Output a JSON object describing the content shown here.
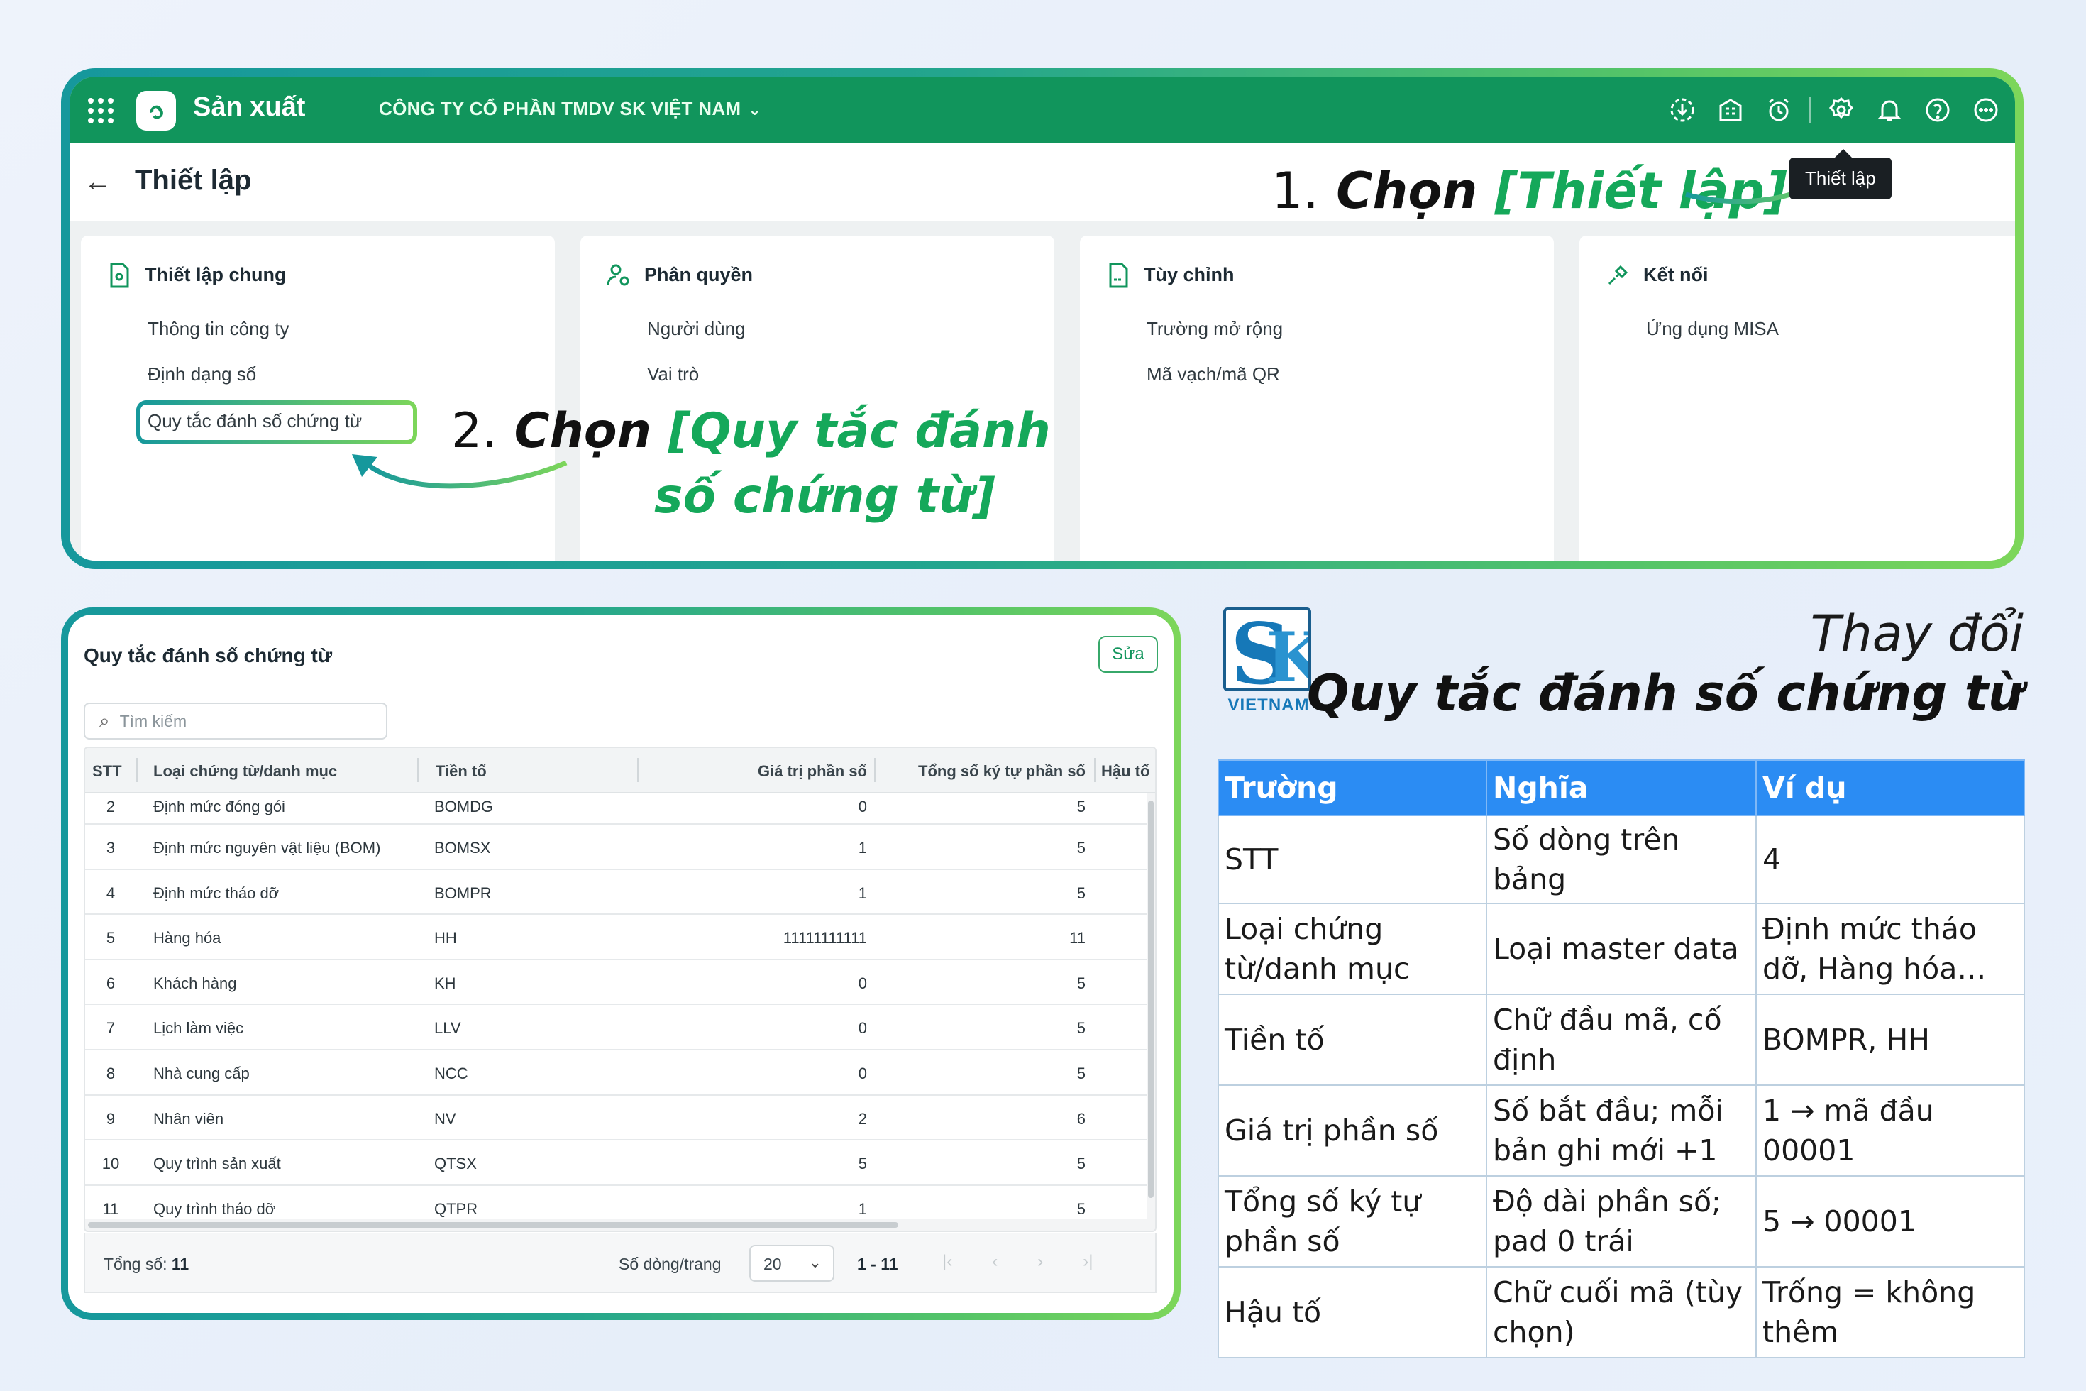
{
  "app": {
    "name": "Sản xuất",
    "company": "CÔNG TY CỔ PHẦN TMDV SK VIỆT NAM",
    "tooltip": "Thiết lập",
    "page_title": "Thiết lập",
    "brand_color": "#11955c",
    "top_icons": [
      "download-icon",
      "building-icon",
      "alarm-icon",
      "gear-icon",
      "bell-icon",
      "help-icon",
      "more-icon"
    ]
  },
  "cards": [
    {
      "title": "Thiết lập chung",
      "icon": "settings-doc-icon",
      "items": [
        "Thông tin công ty",
        "Định dạng số",
        "Quy tắc đánh số chứng từ"
      ]
    },
    {
      "title": "Phân quyền",
      "icon": "user-gear-icon",
      "items": [
        "Người dùng",
        "Vai trò"
      ]
    },
    {
      "title": "Tùy chỉnh",
      "icon": "document-icon",
      "items": [
        "Trường mở rộng",
        "Mã vạch/mã QR"
      ]
    },
    {
      "title": "Kết nối",
      "icon": "plug-icon",
      "items": [
        "Ứng dụng MISA"
      ]
    }
  ],
  "annotations": {
    "step1_num": "1.",
    "step1_text": "Chọn",
    "step1_target": "[Thiết lập]",
    "step2_num": "2.",
    "step2_text": "Chọn",
    "step2_target_line1": "[Quy tắc đánh",
    "step2_target_line2": "số chứng từ]"
  },
  "numbering": {
    "title": "Quy tắc đánh số chứng từ",
    "edit_label": "Sửa",
    "search_placeholder": "Tìm kiếm",
    "columns": [
      "STT",
      "Loại chứng từ/danh mục",
      "Tiền tố",
      "Giá trị phần số",
      "Tổng số ký tự phần số",
      "Hậu tố"
    ],
    "rows": [
      {
        "stt": "2",
        "type": "Định mức đóng gói",
        "prefix": "BOMDG",
        "value": "0",
        "length": "5"
      },
      {
        "stt": "3",
        "type": "Định mức nguyên vật liệu (BOM)",
        "prefix": "BOMSX",
        "value": "1",
        "length": "5"
      },
      {
        "stt": "4",
        "type": "Định mức tháo dỡ",
        "prefix": "BOMPR",
        "value": "1",
        "length": "5"
      },
      {
        "stt": "5",
        "type": "Hàng hóa",
        "prefix": "HH",
        "value": "11111111111",
        "length": "11"
      },
      {
        "stt": "6",
        "type": "Khách hàng",
        "prefix": "KH",
        "value": "0",
        "length": "5"
      },
      {
        "stt": "7",
        "type": "Lịch làm việc",
        "prefix": "LLV",
        "value": "0",
        "length": "5"
      },
      {
        "stt": "8",
        "type": "Nhà cung cấp",
        "prefix": "NCC",
        "value": "0",
        "length": "5"
      },
      {
        "stt": "9",
        "type": "Nhân viên",
        "prefix": "NV",
        "value": "2",
        "length": "6"
      },
      {
        "stt": "10",
        "type": "Quy trình sản xuất",
        "prefix": "QTSX",
        "value": "5",
        "length": "5"
      },
      {
        "stt": "11",
        "type": "Quy trình tháo dỡ",
        "prefix": "QTPR",
        "value": "1",
        "length": "5"
      }
    ],
    "footer": {
      "total_label": "Tổng số:",
      "total_value": "11",
      "rows_per_page_label": "Số dòng/trang",
      "rows_per_page": "20",
      "range": "1 - 11"
    }
  },
  "logo": {
    "text": "VIETNAM"
  },
  "heading": {
    "line1": "Thay đổi",
    "line2": "Quy tắc đánh số chứng từ"
  },
  "info_table": {
    "header_color": "#2b8cf3",
    "headers": [
      "Trường",
      "Nghĩa",
      "Ví dụ"
    ],
    "rows": [
      {
        "field": "STT",
        "meaning": "Số dòng trên bảng",
        "example": "4"
      },
      {
        "field": "Loại chứng từ/danh mục",
        "meaning": "Loại master data",
        "example": "Định mức tháo dỡ, Hàng hóa…"
      },
      {
        "field": "Tiền tố",
        "meaning": "Chữ đầu mã, cố định",
        "example": "BOMPR, HH"
      },
      {
        "field": "Giá trị phần số",
        "meaning": "Số bắt đầu; mỗi bản ghi mới +1",
        "example": "1 → mã đầu 00001"
      },
      {
        "field": "Tổng số ký tự phần số",
        "meaning": "Độ dài phần số; pad 0 trái",
        "example": "5 → 00001"
      },
      {
        "field": "Hậu tố",
        "meaning": "Chữ cuối mã (tùy chọn)",
        "example": "Trống = không thêm"
      }
    ]
  }
}
